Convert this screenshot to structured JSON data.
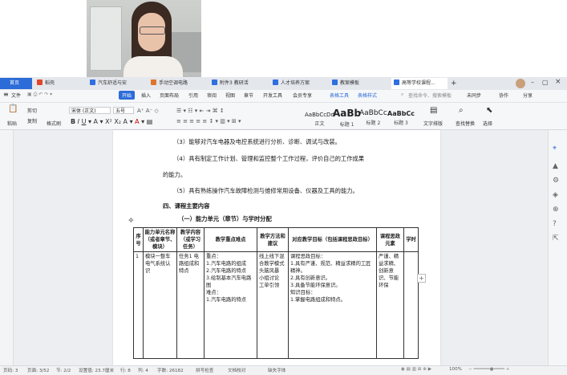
{
  "tabs": [
    {
      "label": "首页"
    },
    {
      "label": "稻壳"
    },
    {
      "label": "汽车舒适与安"
    },
    {
      "label": "手动空调电路"
    },
    {
      "label": "附件3 教研活"
    },
    {
      "label": "人才培养方案"
    },
    {
      "label": "教案模板"
    },
    {
      "label": "高等学校课程..."
    }
  ],
  "new_tab": "+",
  "menu": [
    "文件",
    "开始",
    "插入",
    "页面布局",
    "引用",
    "审阅",
    "视图",
    "章节",
    "开发工具",
    "会员专享",
    "表格工具",
    "表格样式"
  ],
  "menu_right": {
    "search": "查找命令、搜索模板",
    "unsaved": "未同步",
    "collab": "协作",
    "share": "分享"
  },
  "toolbar": {
    "paste": "粘贴",
    "cut": "剪切",
    "copy": "复制",
    "format_painter": "格式刷",
    "font": "宋体 (正文)",
    "size": "五号",
    "styles": [
      {
        "preview": "AaBbCcDd",
        "label": "正文"
      },
      {
        "preview": "AaBb",
        "label": "标题 1"
      },
      {
        "preview": "AaBbCc",
        "label": "标题 2"
      },
      {
        "preview": "AaBbCc",
        "label": "标题 3"
      }
    ],
    "text_tools": "文字排版",
    "find_replace": "查找替换",
    "select": "选择"
  },
  "document": {
    "line1": "（3）能够对汽车电器及电控系统进行分析、诊断、调试与改装。",
    "line2": "（4）具有制定工作计划、管理和监控整个工作过程，评价自己的工作成果",
    "line3": "的能力。",
    "line4": "（5）具有熟练操作汽车故障检测与维修常用设备、仪器及工具的能力。",
    "section": "四、课程主要内容",
    "subsection": "（一）能力单元（章节）与学时分配",
    "table": {
      "headers": [
        "序号",
        "能力单元名称（或者章节、模块）",
        "教学内容（或学习任务）",
        "教学重点难点",
        "教学方法和建议",
        "对应教学目标（包括课程思政目标）",
        "课程思政元素",
        "学时"
      ],
      "row": [
        "1",
        "模块一整车电气系统认识",
        "任务1 电路组成和特点",
        "重点：\n1.汽车电路的组成\n2.汽车电路的特点\n3.绘制基本汽车电路图\n难点：\n1.汽车电路的特点",
        "线上线下混合教学模式\n头脑风暴\n小组讨论\n工单引领",
        "课程思政目标：\n1.具有严谨、规范、精益求精的工匠精神。\n2.具有创新意识。\n3.具备节能环保意识。\n知识目标：\n1.掌握电路组成和特点。",
        "严谨、精益求精、创新意识、节能环保",
        ""
      ]
    }
  },
  "status": {
    "page": "页码: 3",
    "pages": "页面: 3/52",
    "section": "节: 2/2",
    "position": "设置值: 23.7厘米",
    "row": "行: 8",
    "col": "列: 4",
    "words": "字数: 26182",
    "spell": "拼写检查",
    "proof": "文档校对",
    "missing_font": "缺失字体",
    "zoom": "100%"
  }
}
